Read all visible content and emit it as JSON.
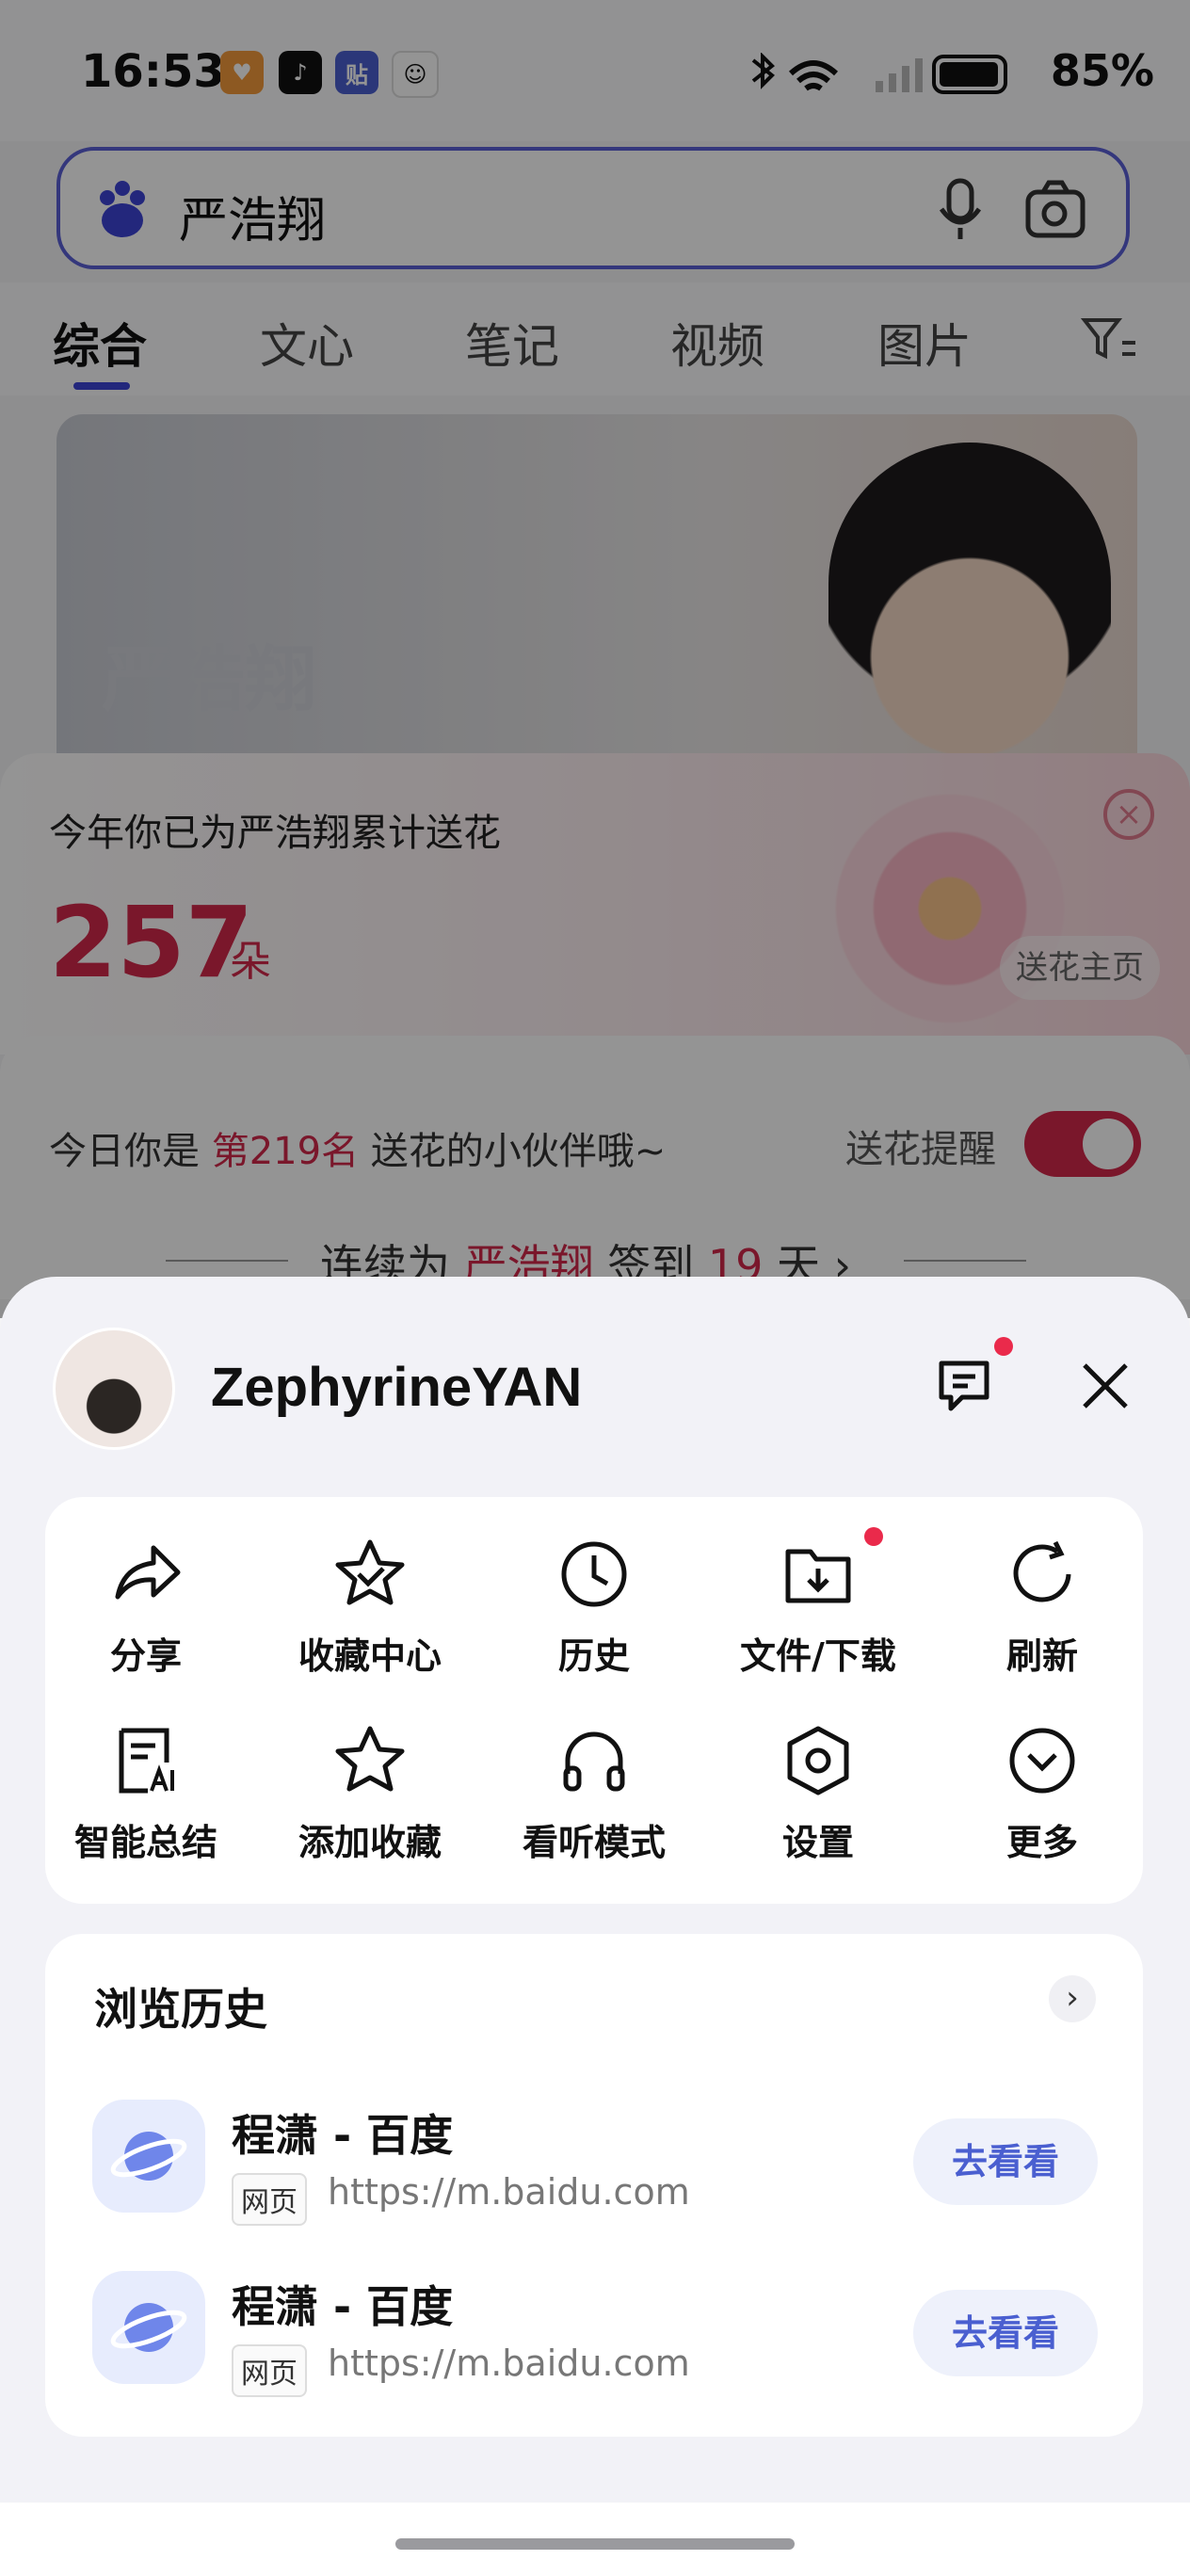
{
  "status_bar": {
    "time": "16:53",
    "battery": "85%"
  },
  "search": {
    "query": "严浩翔"
  },
  "tabs": [
    {
      "label": "综合"
    },
    {
      "label": "文心"
    },
    {
      "label": "笔记"
    },
    {
      "label": "视频"
    },
    {
      "label": "图片"
    }
  ],
  "hero": {
    "title": "严浩翔"
  },
  "flower_card": {
    "label": "今年你已为严浩翔累计送花",
    "count": "257",
    "unit": "朵",
    "home_button": "送花主页"
  },
  "rank_card": {
    "prefix": "今日你是",
    "rank": "第219名",
    "suffix": "送花的小伙伴哦~",
    "remind_label": "送花提醒",
    "remind_on": true,
    "streak_prefix": "连续为",
    "streak_name": "严浩翔",
    "streak_mid": "签到",
    "streak_days": "19",
    "streak_suffix": "天 ›"
  },
  "sheet": {
    "username": "ZephyrineYAN",
    "actions": [
      {
        "label": "分享",
        "icon": "share-icon"
      },
      {
        "label": "收藏中心",
        "icon": "favorites-center-icon"
      },
      {
        "label": "历史",
        "icon": "history-clock-icon"
      },
      {
        "label": "文件/下载",
        "icon": "download-folder-icon"
      },
      {
        "label": "刷新",
        "icon": "refresh-icon"
      },
      {
        "label": "智能总结",
        "icon": "ai-summary-icon"
      },
      {
        "label": "添加收藏",
        "icon": "star-icon"
      },
      {
        "label": "看听模式",
        "icon": "headphones-icon"
      },
      {
        "label": "设置",
        "icon": "settings-hexagon-icon"
      },
      {
        "label": "更多",
        "icon": "more-chevron-icon"
      }
    ],
    "history": {
      "title": "浏览历史",
      "items": [
        {
          "name": "程潇 - 百度",
          "badge": "网页",
          "url": "https://m.baidu.com",
          "button": "去看看"
        },
        {
          "name": "程潇 - 百度",
          "badge": "网页",
          "url": "https://m.baidu.com",
          "button": "去看看"
        }
      ]
    }
  },
  "colors": {
    "accent": "#4a5fd0",
    "brand_red": "#d3284a",
    "search_border": "#5b5fd6"
  }
}
